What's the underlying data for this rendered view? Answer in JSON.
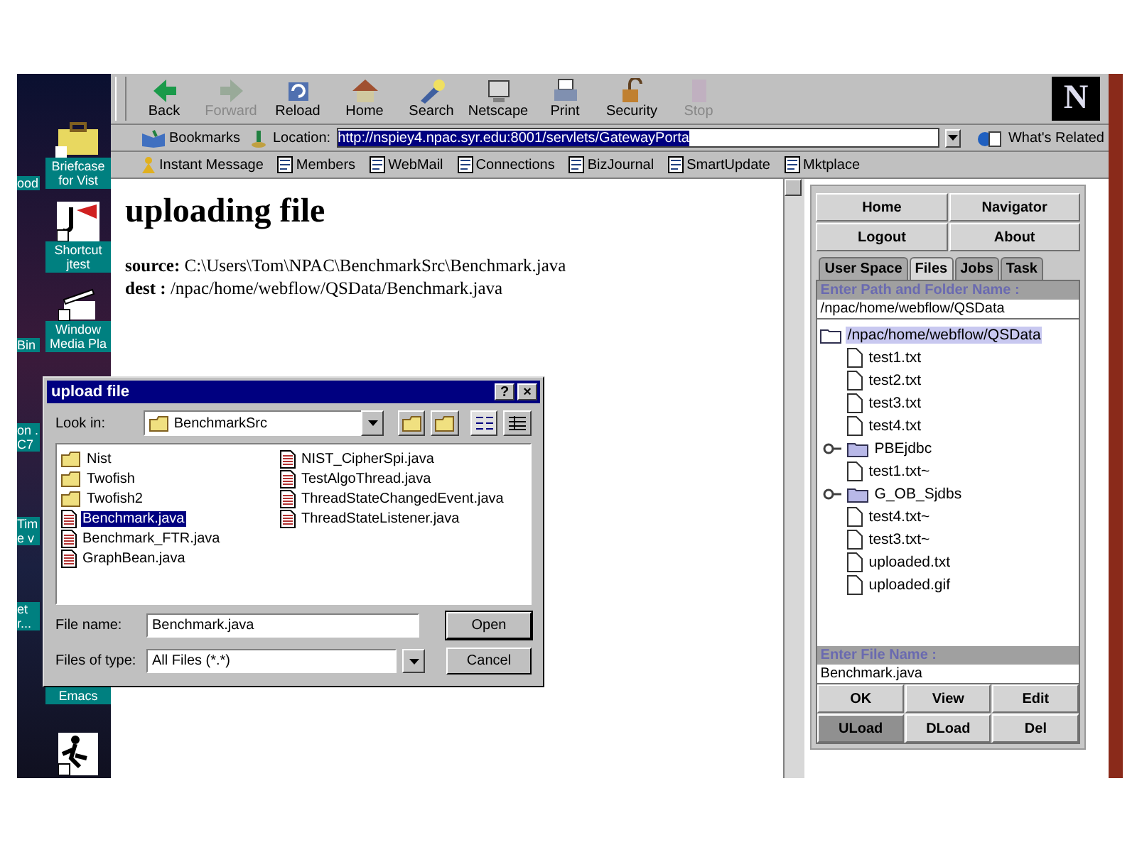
{
  "desktop": {
    "items": [
      {
        "label": "ood",
        "kind": "fragment"
      },
      {
        "label": "Briefcase for Vist",
        "kind": "briefcase"
      },
      {
        "label": "Shortcut jtest",
        "kind": "jtest"
      },
      {
        "label": "Bin",
        "kind": "fragment"
      },
      {
        "label": "Window Media Pla",
        "kind": "media"
      },
      {
        "label": "on .C7",
        "kind": "fragment"
      },
      {
        "label": "Time v",
        "kind": "fragment"
      },
      {
        "label": "et r...",
        "kind": "fragment"
      },
      {
        "label": "Emacs",
        "kind": "plain"
      },
      {
        "kind": "runner"
      }
    ]
  },
  "browser": {
    "nav_buttons": [
      {
        "label": "Back",
        "kind": "back",
        "disabled": false
      },
      {
        "label": "Forward",
        "kind": "forward",
        "disabled": true
      },
      {
        "label": "Reload",
        "kind": "reload",
        "disabled": false
      },
      {
        "label": "Home",
        "kind": "home",
        "disabled": false
      },
      {
        "label": "Search",
        "kind": "search",
        "disabled": false
      },
      {
        "label": "Netscape",
        "kind": "netscape",
        "disabled": false
      },
      {
        "label": "Print",
        "kind": "print",
        "disabled": false
      },
      {
        "label": "Security",
        "kind": "security",
        "disabled": false
      },
      {
        "label": "Stop",
        "kind": "stop",
        "disabled": true
      }
    ],
    "logo": "N",
    "bookmarks": "Bookmarks",
    "location_label": "Location:",
    "url": "http://nspiey4.npac.syr.edu:8001/servlets/GatewayPorta",
    "whats_related": "What's Related",
    "personal": [
      {
        "label": "Instant Message",
        "kind": "person"
      },
      {
        "label": "Members",
        "kind": "bookmark"
      },
      {
        "label": "WebMail",
        "kind": "bookmark"
      },
      {
        "label": "Connections",
        "kind": "bookmark"
      },
      {
        "label": "BizJournal",
        "kind": "bookmark"
      },
      {
        "label": "SmartUpdate",
        "kind": "bookmark"
      },
      {
        "label": "Mktplace",
        "kind": "bookmark"
      }
    ],
    "page": {
      "heading": "uploading file",
      "lines": [
        "**source:** C:\\Users\\Tom\\NPAC\\BenchmarkSrc\\Benchmark.java",
        "**dest :** /npac/home/webflow/QSData/Benchmark.java"
      ]
    }
  },
  "panel": {
    "top_buttons": [
      "Home",
      "Navigator",
      "Logout",
      "About"
    ],
    "tabs": [
      {
        "label": "User Space",
        "selected": false
      },
      {
        "label": "Files",
        "selected": true
      },
      {
        "label": "Jobs",
        "selected": false
      },
      {
        "label": "Task",
        "selected": false
      }
    ],
    "path_label": "Enter Path and Folder Name :",
    "path_value": "/npac/home/webflow/QSData",
    "tree": {
      "label": "/npac/home/webflow/QSData",
      "kind": "folder",
      "selected": true,
      "children": [
        {
          "label": "test1.txt",
          "kind": "file",
          "selected": false
        },
        {
          "label": "test2.txt",
          "kind": "file",
          "selected": false
        },
        {
          "label": "test3.txt",
          "kind": "file",
          "selected": false
        },
        {
          "label": "test4.txt",
          "kind": "file",
          "selected": false
        },
        {
          "label": "PBEjdbc",
          "kind": "folder",
          "selected": false
        },
        {
          "label": "test1.txt~",
          "kind": "file",
          "selected": false
        },
        {
          "label": "G_OB_Sjdbs",
          "kind": "folder",
          "selected": false
        },
        {
          "label": "test4.txt~",
          "kind": "file",
          "selected": false
        },
        {
          "label": "test3.txt~",
          "kind": "file",
          "selected": false
        },
        {
          "label": "uploaded.txt",
          "kind": "file",
          "selected": false
        },
        {
          "label": "uploaded.gif",
          "kind": "file",
          "selected": false
        }
      ]
    },
    "file_label": "Enter File Name :",
    "file_value": "Benchmark.java",
    "actions": [
      {
        "label": "OK",
        "pressed": false
      },
      {
        "label": "View",
        "pressed": false
      },
      {
        "label": "Edit",
        "pressed": false
      },
      {
        "label": "ULoad",
        "pressed": true
      },
      {
        "label": "DLoad",
        "pressed": false
      },
      {
        "label": "Del",
        "pressed": false
      }
    ]
  },
  "dialog": {
    "title": "upload file",
    "help": "?",
    "close": "×",
    "look_in_label": "Look in:",
    "look_in": "BenchmarkSrc",
    "files": [
      {
        "label": "Nist",
        "kind": "folder",
        "selected": false
      },
      {
        "label": "Twofish",
        "kind": "folder",
        "selected": false
      },
      {
        "label": "Twofish2",
        "kind": "folder",
        "selected": false
      },
      {
        "label": "Benchmark.java",
        "kind": "file",
        "selected": true
      },
      {
        "label": "Benchmark_FTR.java",
        "kind": "file",
        "selected": false
      },
      {
        "label": "GraphBean.java",
        "kind": "file",
        "selected": false
      },
      {
        "label": "NIST_CipherSpi.java",
        "kind": "file",
        "selected": false
      },
      {
        "label": "TestAlgoThread.java",
        "kind": "file",
        "selected": false
      },
      {
        "label": "ThreadStateChangedEvent.java",
        "kind": "file",
        "selected": false
      },
      {
        "label": "ThreadStateListener.java",
        "kind": "file",
        "selected": false
      }
    ],
    "file_name_label": "File name:",
    "file_name": "Benchmark.java",
    "type_label": "Files of type:",
    "type_value": "All Files (*.*)",
    "open": "Open",
    "cancel": "Cancel"
  }
}
